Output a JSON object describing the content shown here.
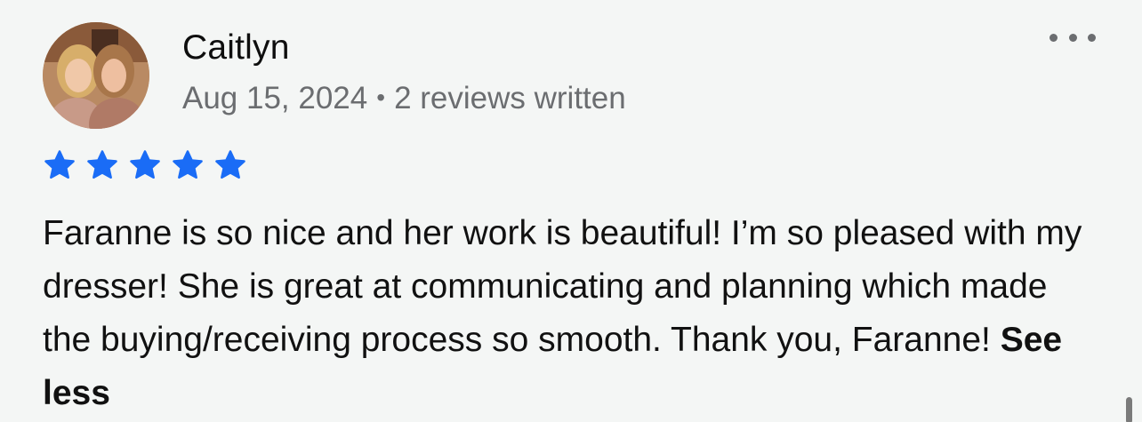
{
  "review": {
    "reviewer_name": "Caitlyn",
    "date": "Aug 15, 2024",
    "separator": "•",
    "reviews_written": "2 reviews written",
    "rating": 5,
    "rating_max": 5,
    "text": "Faranne is so nice and her work is beautiful! I’m so pleased with my dresser! She is great at communicating and planning which made the buying/receiving process so smooth. Thank you, Faranne!",
    "see_less_label": "See less"
  },
  "icons": {
    "more": "more-horizontal-icon",
    "star": "star-filled-icon"
  },
  "colors": {
    "background": "#f4f6f5",
    "star": "#1a6cf6",
    "meta_text": "#6b6d70",
    "body_text": "#111111"
  }
}
